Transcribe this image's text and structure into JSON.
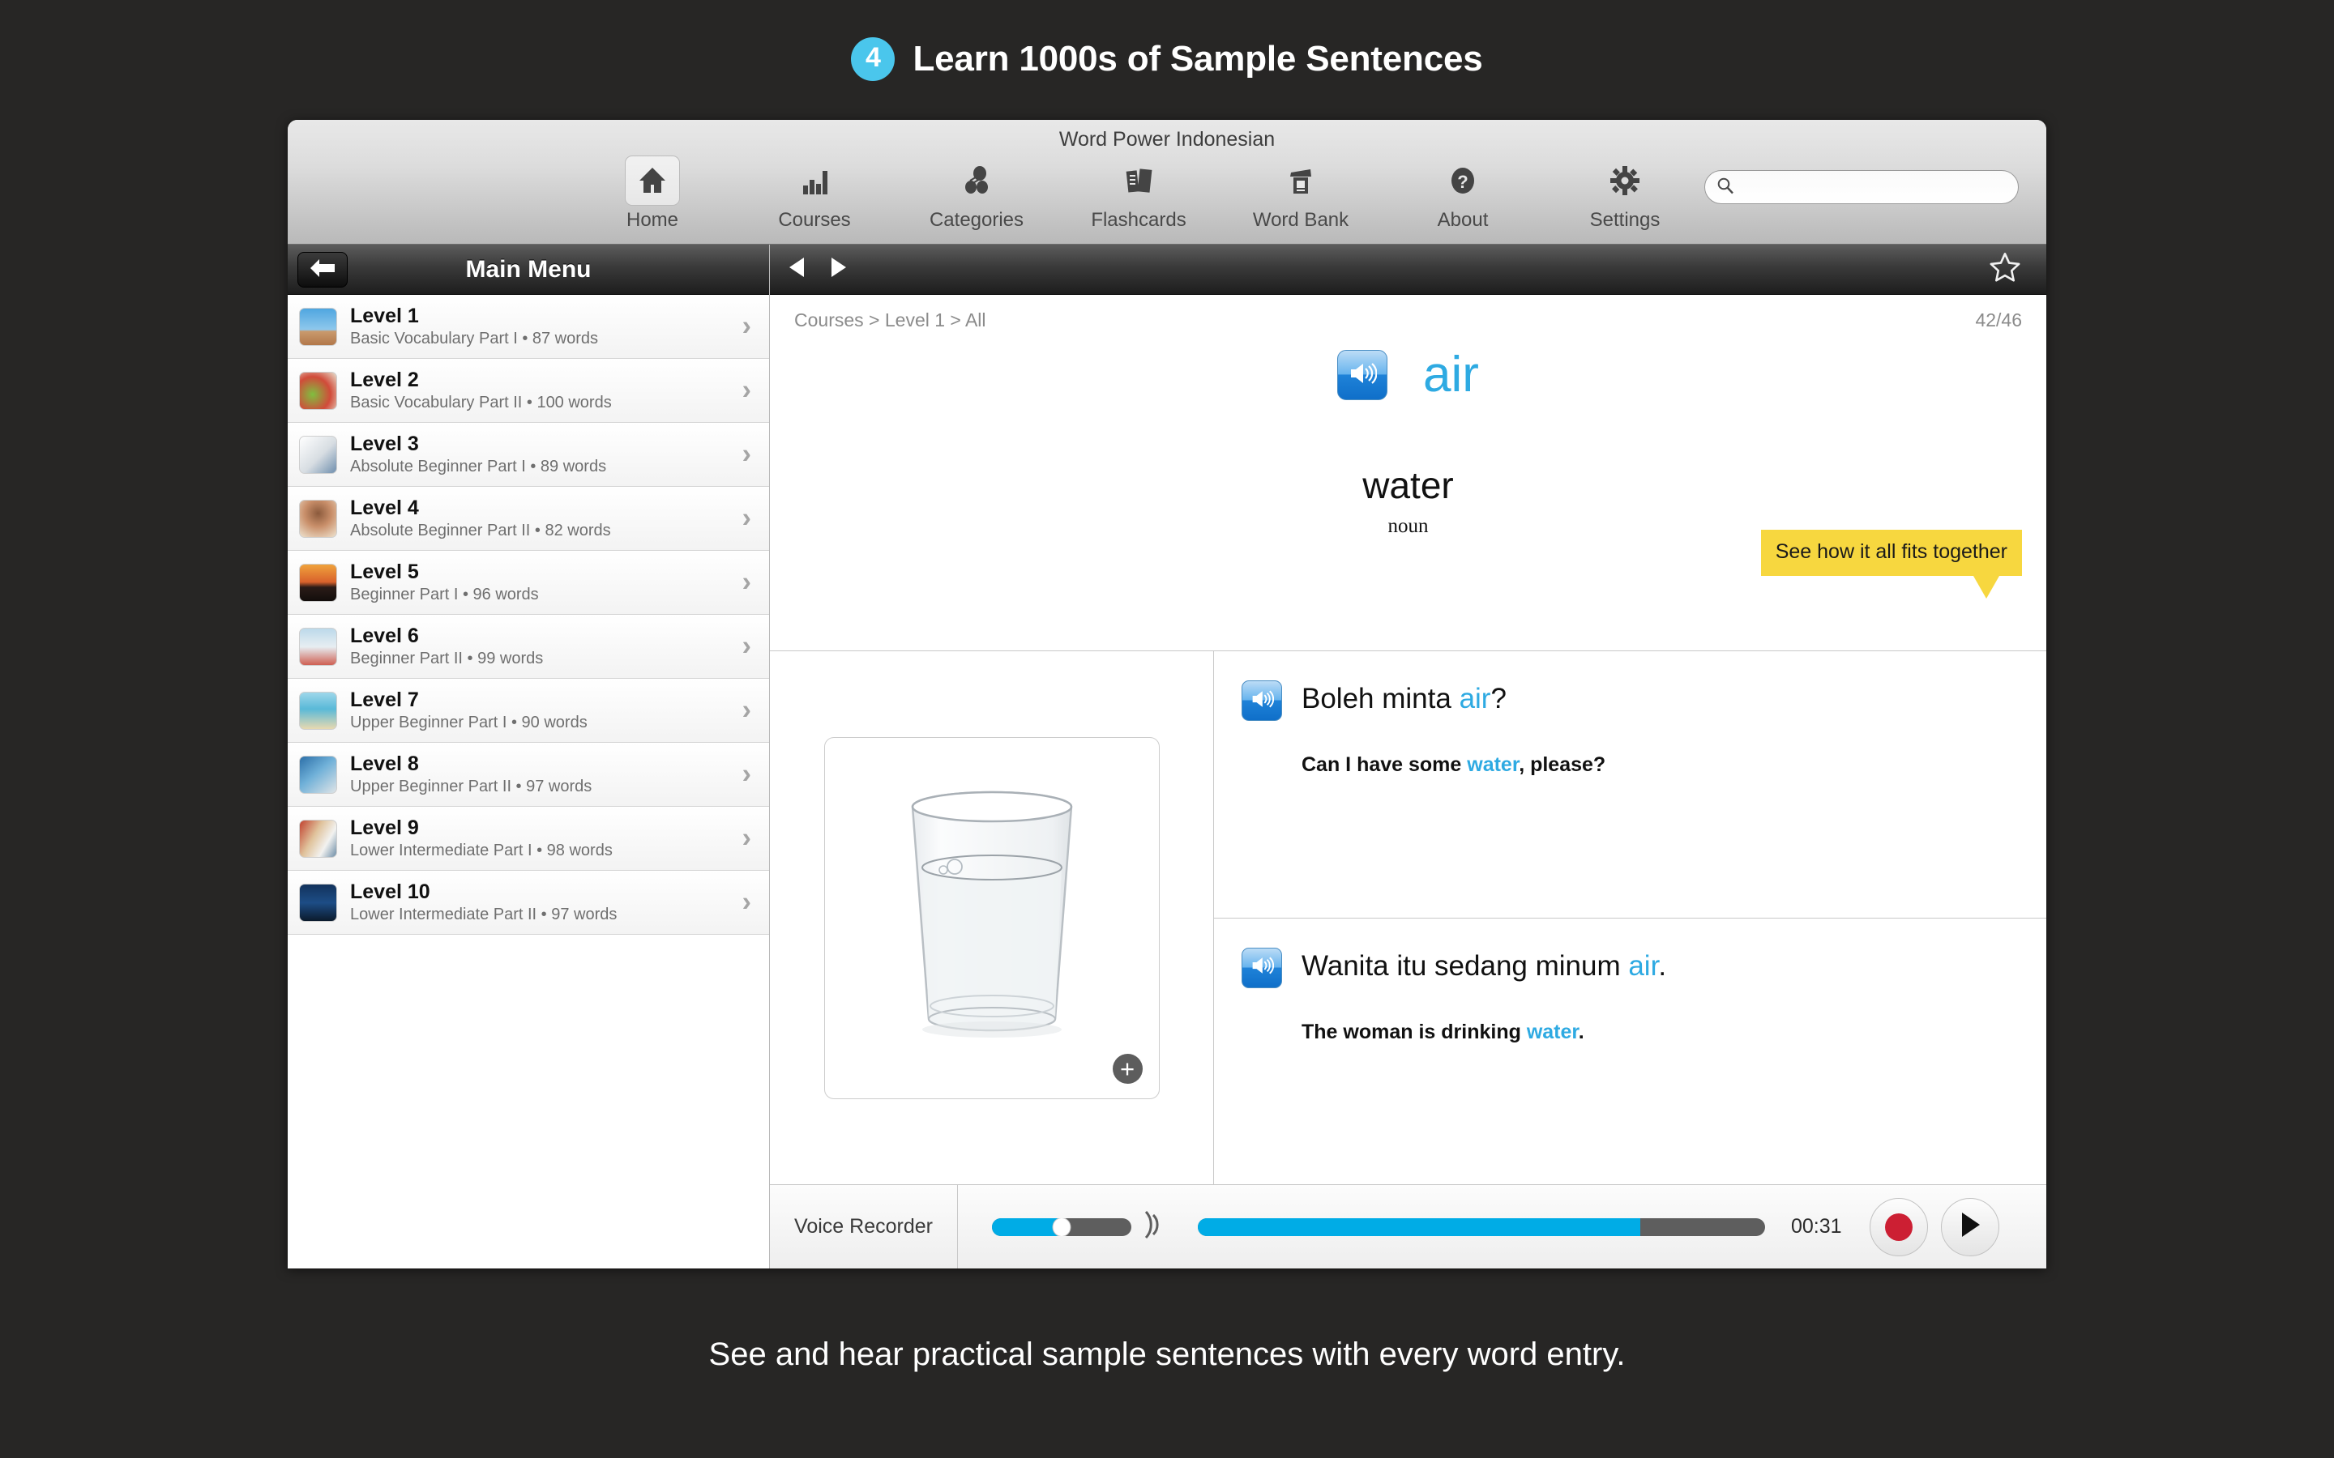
{
  "promo": {
    "badge_number": "4",
    "title": "Learn 1000s of Sample Sentences",
    "caption": "See and hear practical sample sentences with every word entry.",
    "badge_color": "#4ac6ec",
    "background_color": "#272625"
  },
  "window": {
    "title": "Word Power Indonesian"
  },
  "toolbar": {
    "items": [
      {
        "label": "Home",
        "icon": "home-icon",
        "selected": true
      },
      {
        "label": "Courses",
        "icon": "bar-chart-icon",
        "selected": false
      },
      {
        "label": "Categories",
        "icon": "categories-icon",
        "selected": false
      },
      {
        "label": "Flashcards",
        "icon": "flashcards-icon",
        "selected": false
      },
      {
        "label": "Word Bank",
        "icon": "word-bank-icon",
        "selected": false
      },
      {
        "label": "About",
        "icon": "question-icon",
        "selected": false
      },
      {
        "label": "Settings",
        "icon": "gear-icon",
        "selected": false
      }
    ],
    "search": {
      "value": "",
      "placeholder": "",
      "icon": "search-icon"
    }
  },
  "sidebar": {
    "title": "Main Menu",
    "back_icon": "back-arrow-icon",
    "levels": [
      {
        "name": "Level 1",
        "subtitle": "Basic Vocabulary Part I • 87 words",
        "thumb": "hurdler-photo"
      },
      {
        "name": "Level 2",
        "subtitle": "Basic Vocabulary Part II • 100 words",
        "thumb": "vegetables-photo"
      },
      {
        "name": "Level 3",
        "subtitle": "Absolute Beginner Part I • 89 words",
        "thumb": "keys-photo"
      },
      {
        "name": "Level 4",
        "subtitle": "Absolute Beginner Part II • 82 words",
        "thumb": "brushing-teeth-photo"
      },
      {
        "name": "Level 5",
        "subtitle": "Beginner Part I • 96 words",
        "thumb": "sunset-photo"
      },
      {
        "name": "Level 6",
        "subtitle": "Beginner Part II • 99 words",
        "thumb": "bed-photo"
      },
      {
        "name": "Level 7",
        "subtitle": "Upper Beginner Part I • 90 words",
        "thumb": "beach-hammock-photo"
      },
      {
        "name": "Level 8",
        "subtitle": "Upper Beginner Part II • 97 words",
        "thumb": "laptop-photo"
      },
      {
        "name": "Level 9",
        "subtitle": "Lower Intermediate Part I • 98 words",
        "thumb": "classroom-photo"
      },
      {
        "name": "Level 10",
        "subtitle": "Lower Intermediate Part II • 97 words",
        "thumb": "runner-photo"
      }
    ],
    "chevron": "›"
  },
  "content": {
    "prev_icon": "previous-arrow-icon",
    "next_icon": "next-arrow-icon",
    "favorite_icon": "star-outline-icon",
    "breadcrumb": "Courses > Level 1 > All",
    "counter": "42/46",
    "headword": "air",
    "headword_color": "#2eaae2",
    "translation": "water",
    "part_of_speech": "noun",
    "audio_icon": "speaker-icon",
    "callout": "See how it all fits together",
    "callout_color": "#f7d73f",
    "image": {
      "alt": "glass-of-water-photo",
      "zoom_icon": "plus-icon"
    },
    "sentences": [
      {
        "target_pre": "Boleh minta ",
        "target_hl": "air",
        "target_post": "?",
        "translation_pre": "Can I have some ",
        "translation_hl": "water",
        "translation_post": ", please?",
        "audio_icon": "speaker-icon"
      },
      {
        "target_pre": "Wanita itu sedang minum ",
        "target_hl": "air",
        "target_post": ".",
        "translation_pre": "The woman is drinking ",
        "translation_hl": "water",
        "translation_post": ".",
        "audio_icon": "speaker-icon"
      }
    ]
  },
  "recorder": {
    "label": "Voice Recorder",
    "volume_percent": 50,
    "progress_percent": 78,
    "time": "00:31",
    "record_icon": "record-icon",
    "play_icon": "play-icon",
    "accent_color": "#00ace6"
  }
}
